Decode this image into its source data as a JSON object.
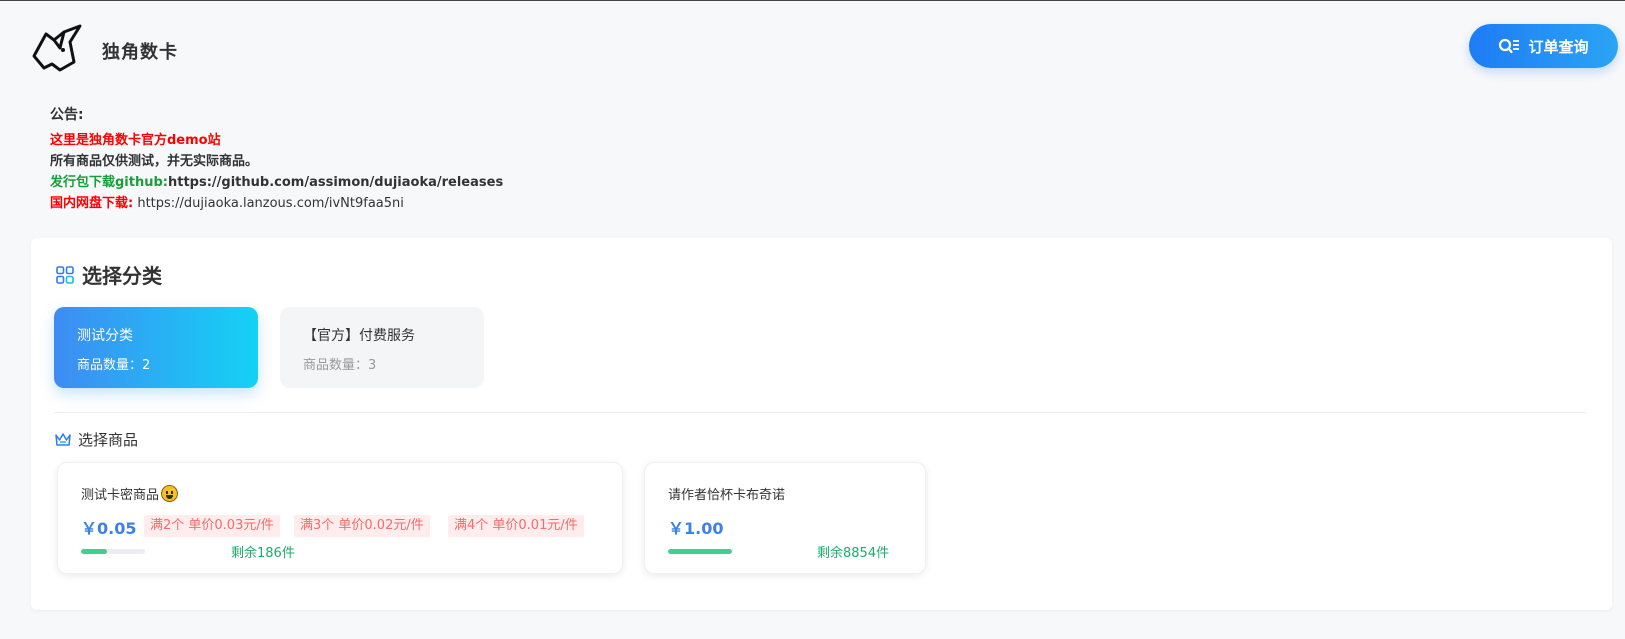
{
  "header": {
    "brand": "独角数卡",
    "order_query_label": "订单查询"
  },
  "notice": {
    "title": "公告:",
    "line1": "这里是独角数卡官方demo站",
    "line2": "所有商品仅供测试，并无实际商品。",
    "line3_label": "发行包下载github:",
    "line3_link": "https://github.com/assimon/dujiaoka/releases",
    "line4_label": "国内网盘下载:",
    "line4_link": " https://dujiaoka.lanzous.com/ivNt9faa5ni"
  },
  "category_section": {
    "title": "选择分类",
    "categories": [
      {
        "name": "测试分类",
        "count": "商品数量：2"
      },
      {
        "name": "【官方】付费服务",
        "count": "商品数量：3"
      }
    ]
  },
  "goods_section": {
    "title": "选择商品",
    "items": [
      {
        "name": "测试卡密商品",
        "price": "￥0.05",
        "tags": [
          "满2个 单价0.03元/件",
          "满3个 单价0.02元/件",
          "满4个 单价0.01元/件"
        ],
        "stock": "剩余186件",
        "stock_fill": 0.4
      },
      {
        "name": "请作者恰杯卡布奇诺",
        "price": "￥1.00",
        "tags": [],
        "stock": "剩余8854件",
        "stock_fill": 1.0
      }
    ]
  },
  "colors": {
    "accent": "#1e7cf5",
    "price": "#3c82e6",
    "tag_bg": "#ffecec",
    "tag_text": "#f56c6c",
    "stock": "#1faa6b"
  },
  "icons": {
    "logo": "unicorn-logo-icon",
    "order_query": "search-list-icon",
    "category": "grid-icon",
    "goods": "crown-icon",
    "emoji": "smiley-emoji-icon"
  }
}
